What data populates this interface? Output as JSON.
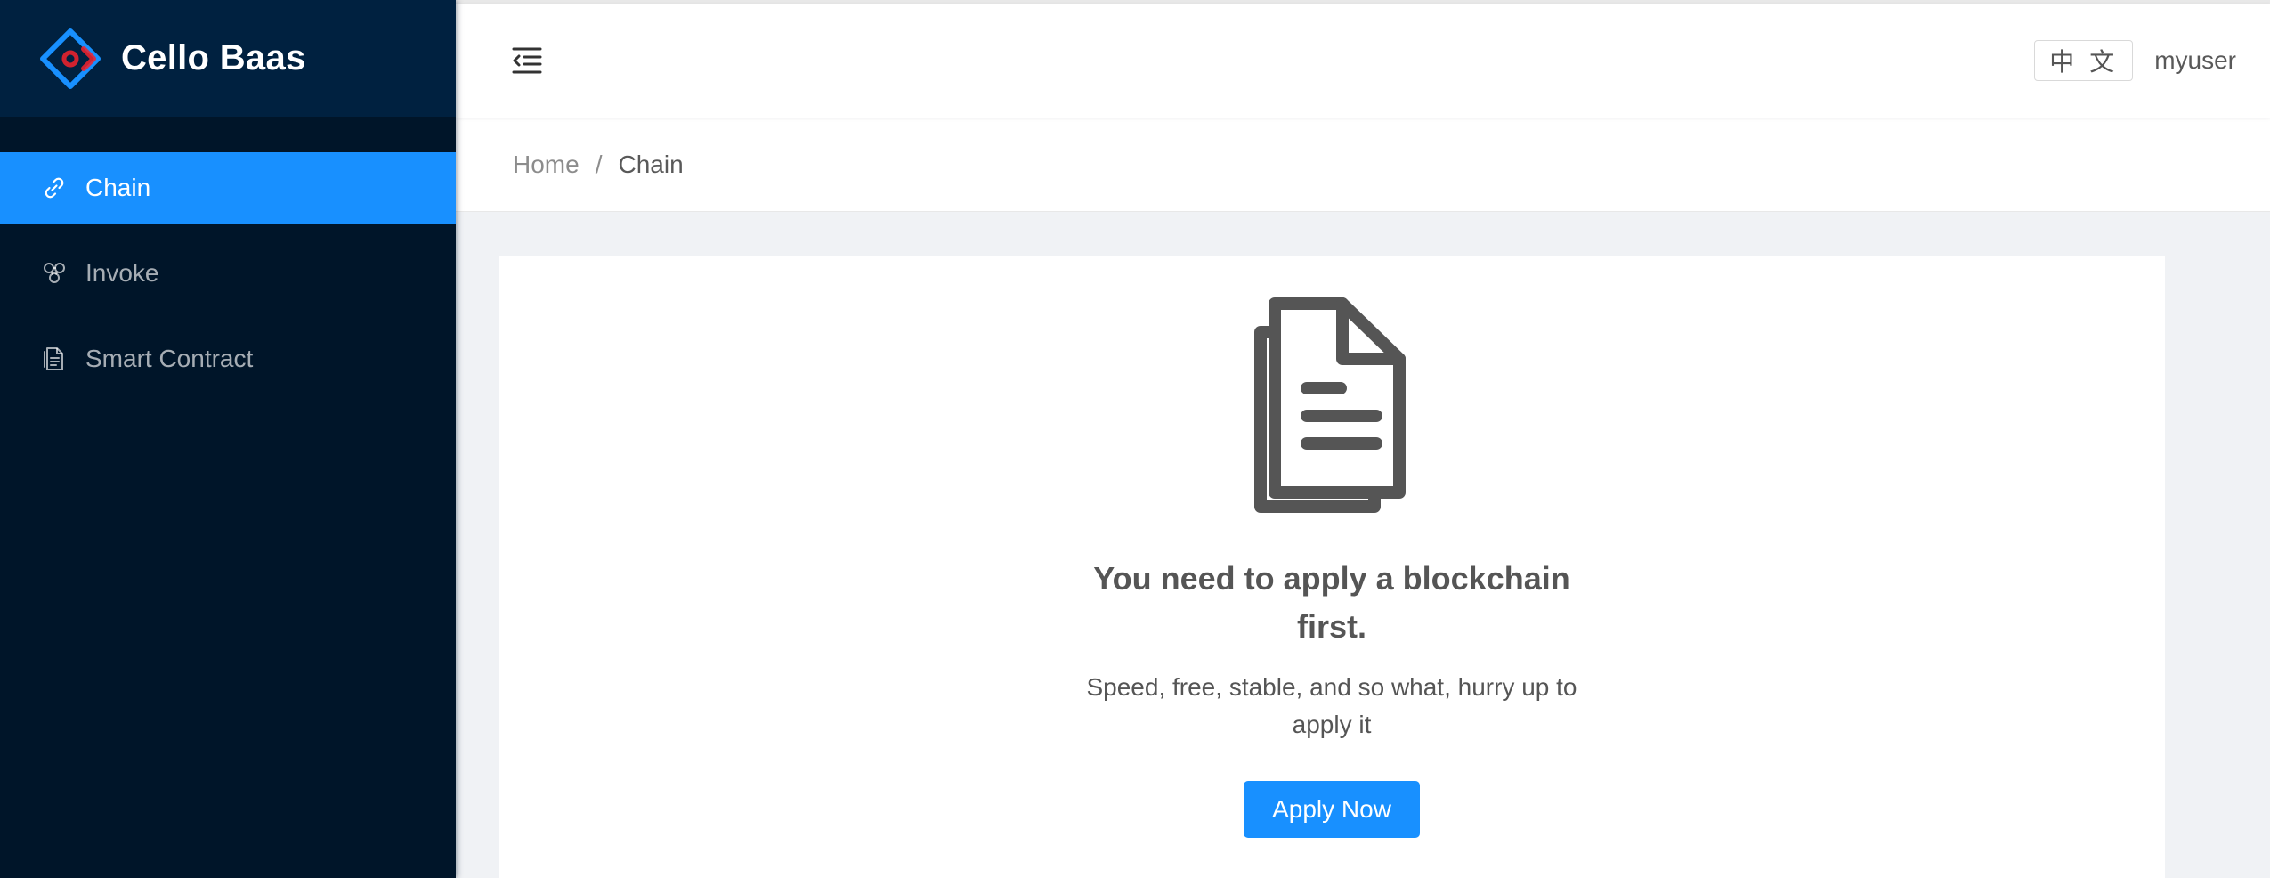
{
  "brand": {
    "title": "Cello Baas",
    "logo_icon": "diamond-logo-icon"
  },
  "sidebar": {
    "items": [
      {
        "label": "Chain",
        "icon": "link-icon",
        "active": true
      },
      {
        "label": "Invoke",
        "icon": "cluster-icon",
        "active": false
      },
      {
        "label": "Smart Contract",
        "icon": "file-text-icon",
        "active": false
      }
    ]
  },
  "header": {
    "trigger_icon": "menu-fold-icon",
    "language": "中 文",
    "username": "myuser"
  },
  "breadcrumb": {
    "home": "Home",
    "separator": "/",
    "current": "Chain"
  },
  "empty_state": {
    "icon": "copy-document-icon",
    "title": "You need to apply a blockchain first.",
    "description": "Speed, free, stable, and so what, hurry up to apply it",
    "button_label": "Apply Now"
  },
  "colors": {
    "sidebar_bg": "#001529",
    "brand_bg": "#002140",
    "primary": "#1890ff",
    "page_bg": "#f0f2f5"
  }
}
